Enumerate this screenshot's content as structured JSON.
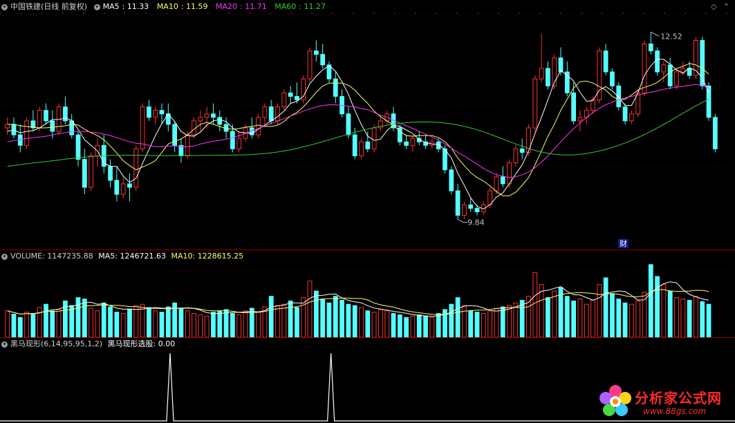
{
  "header": {
    "title": "中国铁建(日线 前复权)",
    "ma_labels": [
      {
        "name": "MA5",
        "value": "11.33",
        "color": "#ffffff"
      },
      {
        "name": "MA10",
        "value": "11.59",
        "color": "#ffff66"
      },
      {
        "name": "MA20",
        "value": "11.71",
        "color": "#ff33ff"
      },
      {
        "name": "MA60",
        "value": "11.27",
        "color": "#33cc33"
      }
    ]
  },
  "price_panel": {
    "high_label": "12.52",
    "low_label": "9.84",
    "finance_badge": "财",
    "candle_up_color": "#ff3232",
    "candle_down_color": "#54ffff"
  },
  "volume_panel": {
    "label": "VOLUME: 1147235.88",
    "ma5": "MA5: 1246721.63",
    "ma10": "MA10: 1228615.25"
  },
  "indicator_panel": {
    "label": "黑马现形(6,14,95,95,1,2)",
    "value_label": "黑马现形选股: 0.00"
  },
  "watermark": {
    "title": "分析家公式网",
    "url": "www.88gs.com"
  },
  "chart_data": [
    {
      "type": "candlestick",
      "title": "中国铁建(日线 前复权)",
      "ylim": [
        9.5,
        12.8
      ],
      "annotations": [
        {
          "text": "12.52",
          "value": 12.52
        },
        {
          "text": "9.84",
          "value": 9.84
        }
      ],
      "ohlc": [
        [
          11.15,
          11.3,
          11.05,
          11.2
        ],
        [
          11.2,
          11.3,
          11.0,
          11.05
        ],
        [
          11.05,
          11.2,
          10.8,
          10.9
        ],
        [
          10.9,
          11.3,
          10.85,
          11.25
        ],
        [
          11.25,
          11.4,
          11.1,
          11.15
        ],
        [
          11.15,
          11.45,
          11.1,
          11.4
        ],
        [
          11.4,
          11.5,
          11.2,
          11.25
        ],
        [
          11.25,
          11.4,
          11.0,
          11.1
        ],
        [
          11.1,
          11.5,
          11.05,
          11.45
        ],
        [
          11.45,
          11.6,
          11.2,
          11.25
        ],
        [
          11.25,
          11.35,
          11.0,
          11.05
        ],
        [
          11.05,
          11.1,
          10.6,
          10.7
        ],
        [
          10.7,
          10.85,
          10.2,
          10.3
        ],
        [
          10.3,
          10.8,
          10.25,
          10.75
        ],
        [
          10.75,
          11.0,
          10.6,
          10.9
        ],
        [
          10.9,
          11.05,
          10.5,
          10.6
        ],
        [
          10.6,
          10.7,
          10.3,
          10.4
        ],
        [
          10.4,
          10.6,
          10.1,
          10.2
        ],
        [
          10.2,
          10.45,
          10.15,
          10.35
        ],
        [
          10.35,
          10.5,
          10.1,
          10.3
        ],
        [
          10.3,
          10.9,
          10.25,
          10.85
        ],
        [
          10.85,
          11.5,
          10.8,
          11.45
        ],
        [
          11.45,
          11.55,
          11.25,
          11.3
        ],
        [
          11.3,
          11.45,
          11.2,
          11.4
        ],
        [
          11.4,
          11.5,
          11.2,
          11.35
        ],
        [
          11.35,
          11.5,
          11.1,
          11.2
        ],
        [
          11.2,
          11.25,
          10.8,
          10.9
        ],
        [
          10.9,
          11.0,
          10.65,
          10.75
        ],
        [
          10.75,
          11.1,
          10.7,
          11.05
        ],
        [
          11.05,
          11.3,
          11.0,
          11.25
        ],
        [
          11.25,
          11.4,
          11.1,
          11.3
        ],
        [
          11.3,
          11.45,
          11.15,
          11.35
        ],
        [
          11.35,
          11.5,
          11.2,
          11.3
        ],
        [
          11.3,
          11.4,
          11.1,
          11.2
        ],
        [
          11.2,
          11.3,
          11.0,
          11.1
        ],
        [
          11.1,
          11.2,
          10.8,
          10.85
        ],
        [
          10.85,
          11.1,
          10.8,
          11.0
        ],
        [
          11.0,
          11.2,
          10.95,
          11.15
        ],
        [
          11.15,
          11.3,
          11.0,
          11.05
        ],
        [
          11.05,
          11.35,
          11.0,
          11.3
        ],
        [
          11.3,
          11.5,
          11.2,
          11.45
        ],
        [
          11.45,
          11.55,
          11.2,
          11.25
        ],
        [
          11.25,
          11.5,
          11.2,
          11.45
        ],
        [
          11.45,
          11.7,
          11.4,
          11.65
        ],
        [
          11.65,
          11.75,
          11.5,
          11.6
        ],
        [
          11.6,
          11.8,
          11.5,
          11.55
        ],
        [
          11.55,
          11.9,
          11.5,
          11.85
        ],
        [
          11.85,
          12.3,
          11.8,
          12.25
        ],
        [
          12.25,
          12.4,
          12.1,
          12.2
        ],
        [
          12.2,
          12.35,
          12.0,
          12.05
        ],
        [
          12.05,
          12.1,
          11.8,
          11.85
        ],
        [
          11.85,
          11.95,
          11.5,
          11.6
        ],
        [
          11.6,
          11.7,
          11.3,
          11.35
        ],
        [
          11.35,
          11.45,
          11.0,
          11.05
        ],
        [
          11.05,
          11.15,
          10.7,
          10.75
        ],
        [
          10.75,
          11.0,
          10.7,
          10.95
        ],
        [
          10.95,
          11.1,
          10.8,
          10.85
        ],
        [
          10.85,
          11.2,
          10.8,
          11.15
        ],
        [
          11.15,
          11.3,
          11.1,
          11.25
        ],
        [
          11.25,
          11.4,
          11.2,
          11.35
        ],
        [
          11.35,
          11.45,
          11.1,
          11.15
        ],
        [
          11.15,
          11.2,
          10.9,
          10.95
        ],
        [
          10.95,
          11.05,
          10.85,
          10.9
        ],
        [
          10.9,
          11.05,
          10.8,
          11.0
        ],
        [
          11.0,
          11.1,
          10.9,
          10.95
        ],
        [
          10.95,
          11.05,
          10.85,
          10.9
        ],
        [
          10.9,
          11.0,
          10.85,
          10.95
        ],
        [
          10.95,
          11.0,
          10.8,
          10.85
        ],
        [
          10.85,
          10.9,
          10.5,
          10.55
        ],
        [
          10.55,
          10.6,
          10.2,
          10.25
        ],
        [
          10.25,
          10.35,
          9.84,
          9.9
        ],
        [
          9.9,
          10.1,
          9.85,
          10.05
        ],
        [
          10.05,
          10.15,
          9.95,
          10.0
        ],
        [
          10.0,
          10.05,
          9.9,
          9.95
        ],
        [
          9.95,
          10.1,
          9.9,
          10.05
        ],
        [
          10.05,
          10.3,
          10.0,
          10.25
        ],
        [
          10.25,
          10.5,
          10.2,
          10.45
        ],
        [
          10.45,
          10.6,
          10.3,
          10.35
        ],
        [
          10.35,
          10.7,
          10.3,
          10.65
        ],
        [
          10.65,
          10.9,
          10.6,
          10.85
        ],
        [
          10.85,
          11.0,
          10.7,
          10.8
        ],
        [
          10.8,
          11.2,
          10.75,
          11.15
        ],
        [
          11.15,
          11.9,
          11.1,
          11.85
        ],
        [
          11.85,
          12.5,
          11.8,
          12.0
        ],
        [
          12.0,
          12.1,
          11.7,
          11.75
        ],
        [
          11.75,
          12.2,
          11.7,
          12.15
        ],
        [
          12.15,
          12.3,
          11.9,
          11.95
        ],
        [
          11.95,
          12.1,
          11.6,
          11.65
        ],
        [
          11.65,
          11.8,
          11.2,
          11.25
        ],
        [
          11.25,
          11.4,
          11.1,
          11.3
        ],
        [
          11.3,
          11.45,
          11.2,
          11.4
        ],
        [
          11.4,
          11.6,
          11.35,
          11.55
        ],
        [
          11.55,
          12.3,
          11.5,
          12.25
        ],
        [
          12.25,
          12.35,
          11.9,
          11.95
        ],
        [
          11.95,
          12.0,
          11.7,
          11.75
        ],
        [
          11.75,
          11.8,
          11.4,
          11.45
        ],
        [
          11.45,
          11.5,
          11.2,
          11.25
        ],
        [
          11.25,
          11.4,
          11.2,
          11.35
        ],
        [
          11.35,
          11.7,
          11.3,
          11.65
        ],
        [
          11.65,
          12.4,
          11.6,
          12.35
        ],
        [
          12.35,
          12.52,
          12.2,
          12.25
        ],
        [
          12.25,
          12.3,
          11.9,
          11.95
        ],
        [
          11.95,
          12.1,
          11.8,
          12.05
        ],
        [
          12.05,
          12.15,
          11.7,
          11.75
        ],
        [
          11.75,
          12.0,
          11.7,
          11.95
        ],
        [
          11.95,
          12.1,
          11.9,
          12.0
        ],
        [
          12.0,
          12.1,
          11.85,
          11.9
        ],
        [
          11.9,
          12.45,
          11.85,
          12.4
        ],
        [
          12.4,
          12.45,
          11.7,
          11.75
        ],
        [
          11.75,
          11.8,
          11.25,
          11.3
        ],
        [
          11.3,
          11.35,
          10.8,
          10.85
        ]
      ],
      "ma": {
        "MA5": [
          11.1,
          11.12,
          11.08,
          11.1,
          11.11,
          11.15,
          11.21,
          11.27,
          11.27,
          11.29,
          11.26,
          11.13,
          10.98,
          10.9,
          10.82,
          10.65,
          10.6,
          10.6,
          10.46,
          10.37,
          10.43,
          10.64,
          10.84,
          11.04,
          11.21,
          11.35,
          11.24,
          11.1,
          11.04,
          11.03,
          11.09,
          11.19,
          11.25,
          11.27,
          11.24,
          11.15,
          11.09,
          11.08,
          11.07,
          11.13,
          11.19,
          11.25,
          11.31,
          11.39,
          11.5,
          11.53,
          11.6,
          11.78,
          11.89,
          11.98,
          12.04,
          11.96,
          11.81,
          11.63,
          11.4,
          11.2,
          11.03,
          10.97,
          10.99,
          11.11,
          11.19,
          11.17,
          11.12,
          11.07,
          10.98,
          10.94,
          10.92,
          10.91,
          10.84,
          10.72,
          10.5,
          10.33,
          10.15,
          10.03,
          9.99,
          10.05,
          10.16,
          10.22,
          10.35,
          10.49,
          10.62,
          10.82,
          11.07,
          11.3,
          11.55,
          11.8,
          11.97,
          11.9,
          11.82,
          11.66,
          11.53,
          11.54,
          11.69,
          11.74,
          11.68,
          11.59,
          11.47,
          11.47,
          11.65,
          11.9,
          12.04,
          12.13,
          12.13,
          12.06,
          11.98,
          11.93,
          12.01,
          11.97,
          11.87,
          11.65
        ],
        "MA10": [
          11.2,
          11.2,
          11.18,
          11.17,
          11.16,
          11.15,
          11.15,
          11.16,
          11.17,
          11.18,
          11.2,
          11.19,
          11.13,
          11.08,
          11.04,
          10.98,
          10.89,
          10.79,
          10.68,
          10.61,
          10.55,
          10.59,
          10.63,
          10.68,
          10.8,
          10.92,
          10.96,
          10.99,
          11.05,
          11.13,
          11.2,
          11.23,
          11.2,
          11.17,
          11.14,
          11.13,
          11.14,
          11.16,
          11.17,
          11.19,
          11.17,
          11.17,
          11.19,
          11.24,
          11.32,
          11.37,
          11.45,
          11.55,
          11.66,
          11.75,
          11.79,
          11.79,
          11.79,
          11.76,
          11.69,
          11.59,
          11.5,
          11.39,
          11.31,
          11.25,
          11.19,
          11.1,
          11.04,
          11.03,
          11.04,
          11.04,
          11.04,
          11.01,
          10.95,
          10.86,
          10.72,
          10.61,
          10.51,
          10.44,
          10.39,
          10.32,
          10.24,
          10.18,
          10.18,
          10.23,
          10.33,
          10.44,
          10.62,
          10.82,
          11.03,
          11.2,
          11.4,
          11.56,
          11.72,
          11.81,
          11.82,
          11.79,
          11.74,
          11.69,
          11.6,
          11.55,
          11.56,
          11.62,
          11.69,
          11.73,
          11.76,
          11.8,
          11.87,
          11.95,
          12.0,
          12.03,
          12.07,
          12.05,
          12.0,
          11.92
        ],
        "MA20": [
          10.95,
          10.97,
          10.98,
          11.0,
          11.01,
          11.02,
          11.03,
          11.05,
          11.07,
          11.08,
          11.1,
          11.1,
          11.1,
          11.09,
          11.08,
          11.06,
          11.04,
          11.01,
          10.98,
          10.95,
          10.93,
          10.92,
          10.9,
          10.88,
          10.88,
          10.89,
          10.89,
          10.88,
          10.88,
          10.89,
          10.92,
          10.94,
          10.96,
          10.97,
          10.99,
          11.01,
          11.04,
          11.07,
          11.11,
          11.14,
          11.18,
          11.21,
          11.25,
          11.28,
          11.32,
          11.35,
          11.39,
          11.42,
          11.45,
          11.47,
          11.48,
          11.48,
          11.47,
          11.46,
          11.45,
          11.43,
          11.41,
          11.37,
          11.33,
          11.3,
          11.26,
          11.22,
          11.18,
          11.14,
          11.1,
          11.06,
          11.02,
          10.97,
          10.92,
          10.86,
          10.8,
          10.75,
          10.69,
          10.63,
          10.57,
          10.52,
          10.48,
          10.46,
          10.44,
          10.45,
          10.48,
          10.52,
          10.58,
          10.66,
          10.75,
          10.85,
          10.95,
          11.05,
          11.14,
          11.22,
          11.3,
          11.37,
          11.43,
          11.48,
          11.52,
          11.55,
          11.58,
          11.6,
          11.62,
          11.64,
          11.66,
          11.68,
          11.7,
          11.72,
          11.73,
          11.74,
          11.76,
          11.77,
          11.76,
          11.71
        ]
      }
    },
    {
      "type": "bar",
      "title": "VOLUME",
      "values_note": "relative heights of volume bars",
      "values": [
        40,
        35,
        30,
        38,
        36,
        45,
        50,
        40,
        42,
        55,
        48,
        60,
        58,
        44,
        40,
        52,
        46,
        38,
        36,
        42,
        48,
        50,
        45,
        40,
        38,
        46,
        52,
        44,
        40,
        36,
        34,
        32,
        38,
        40,
        42,
        36,
        34,
        40,
        44,
        38,
        46,
        62,
        48,
        50,
        55,
        45,
        60,
        85,
        70,
        58,
        52,
        62,
        56,
        50,
        48,
        45,
        40,
        38,
        42,
        40,
        36,
        34,
        30,
        32,
        34,
        32,
        30,
        36,
        42,
        50,
        60,
        48,
        40,
        38,
        36,
        40,
        44,
        46,
        48,
        52,
        56,
        62,
        98,
        80,
        60,
        70,
        75,
        62,
        55,
        58,
        50,
        56,
        80,
        90,
        66,
        58,
        52,
        50,
        55,
        68,
        110,
        92,
        80,
        70,
        60,
        58,
        56,
        62,
        54,
        50
      ],
      "MA5_label": "1246721.63",
      "MA10_label": "1228615.25"
    },
    {
      "type": "line",
      "title": "黑马现形(6,14,95,95,1,2)",
      "series": [
        {
          "name": "黑马现形选股",
          "spikes_at_index": [
            24,
            49
          ],
          "value_current": 0.0
        }
      ]
    }
  ]
}
